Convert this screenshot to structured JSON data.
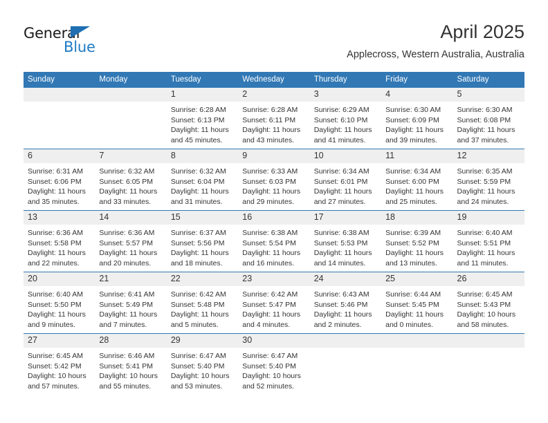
{
  "logo": {
    "word_one": "General",
    "word_two": "Blue",
    "flag_icon": "triangle-flag-icon",
    "accent_color": "#1f7ac4"
  },
  "header": {
    "title": "April 2025",
    "subtitle": "Applecross, Western Australia, Australia"
  },
  "theme": {
    "header_blue": "#3178b5",
    "daynum_gray": "#efefef",
    "text": "#333333"
  },
  "weekday_headers": [
    "Sunday",
    "Monday",
    "Tuesday",
    "Wednesday",
    "Thursday",
    "Friday",
    "Saturday"
  ],
  "weeks": [
    [
      {
        "day": "",
        "lines": []
      },
      {
        "day": "",
        "lines": []
      },
      {
        "day": "1",
        "lines": [
          "Sunrise: 6:28 AM",
          "Sunset: 6:13 PM",
          "Daylight: 11 hours",
          "and 45 minutes."
        ]
      },
      {
        "day": "2",
        "lines": [
          "Sunrise: 6:28 AM",
          "Sunset: 6:11 PM",
          "Daylight: 11 hours",
          "and 43 minutes."
        ]
      },
      {
        "day": "3",
        "lines": [
          "Sunrise: 6:29 AM",
          "Sunset: 6:10 PM",
          "Daylight: 11 hours",
          "and 41 minutes."
        ]
      },
      {
        "day": "4",
        "lines": [
          "Sunrise: 6:30 AM",
          "Sunset: 6:09 PM",
          "Daylight: 11 hours",
          "and 39 minutes."
        ]
      },
      {
        "day": "5",
        "lines": [
          "Sunrise: 6:30 AM",
          "Sunset: 6:08 PM",
          "Daylight: 11 hours",
          "and 37 minutes."
        ]
      }
    ],
    [
      {
        "day": "6",
        "lines": [
          "Sunrise: 6:31 AM",
          "Sunset: 6:06 PM",
          "Daylight: 11 hours",
          "and 35 minutes."
        ]
      },
      {
        "day": "7",
        "lines": [
          "Sunrise: 6:32 AM",
          "Sunset: 6:05 PM",
          "Daylight: 11 hours",
          "and 33 minutes."
        ]
      },
      {
        "day": "8",
        "lines": [
          "Sunrise: 6:32 AM",
          "Sunset: 6:04 PM",
          "Daylight: 11 hours",
          "and 31 minutes."
        ]
      },
      {
        "day": "9",
        "lines": [
          "Sunrise: 6:33 AM",
          "Sunset: 6:03 PM",
          "Daylight: 11 hours",
          "and 29 minutes."
        ]
      },
      {
        "day": "10",
        "lines": [
          "Sunrise: 6:34 AM",
          "Sunset: 6:01 PM",
          "Daylight: 11 hours",
          "and 27 minutes."
        ]
      },
      {
        "day": "11",
        "lines": [
          "Sunrise: 6:34 AM",
          "Sunset: 6:00 PM",
          "Daylight: 11 hours",
          "and 25 minutes."
        ]
      },
      {
        "day": "12",
        "lines": [
          "Sunrise: 6:35 AM",
          "Sunset: 5:59 PM",
          "Daylight: 11 hours",
          "and 24 minutes."
        ]
      }
    ],
    [
      {
        "day": "13",
        "lines": [
          "Sunrise: 6:36 AM",
          "Sunset: 5:58 PM",
          "Daylight: 11 hours",
          "and 22 minutes."
        ]
      },
      {
        "day": "14",
        "lines": [
          "Sunrise: 6:36 AM",
          "Sunset: 5:57 PM",
          "Daylight: 11 hours",
          "and 20 minutes."
        ]
      },
      {
        "day": "15",
        "lines": [
          "Sunrise: 6:37 AM",
          "Sunset: 5:56 PM",
          "Daylight: 11 hours",
          "and 18 minutes."
        ]
      },
      {
        "day": "16",
        "lines": [
          "Sunrise: 6:38 AM",
          "Sunset: 5:54 PM",
          "Daylight: 11 hours",
          "and 16 minutes."
        ]
      },
      {
        "day": "17",
        "lines": [
          "Sunrise: 6:38 AM",
          "Sunset: 5:53 PM",
          "Daylight: 11 hours",
          "and 14 minutes."
        ]
      },
      {
        "day": "18",
        "lines": [
          "Sunrise: 6:39 AM",
          "Sunset: 5:52 PM",
          "Daylight: 11 hours",
          "and 13 minutes."
        ]
      },
      {
        "day": "19",
        "lines": [
          "Sunrise: 6:40 AM",
          "Sunset: 5:51 PM",
          "Daylight: 11 hours",
          "and 11 minutes."
        ]
      }
    ],
    [
      {
        "day": "20",
        "lines": [
          "Sunrise: 6:40 AM",
          "Sunset: 5:50 PM",
          "Daylight: 11 hours",
          "and 9 minutes."
        ]
      },
      {
        "day": "21",
        "lines": [
          "Sunrise: 6:41 AM",
          "Sunset: 5:49 PM",
          "Daylight: 11 hours",
          "and 7 minutes."
        ]
      },
      {
        "day": "22",
        "lines": [
          "Sunrise: 6:42 AM",
          "Sunset: 5:48 PM",
          "Daylight: 11 hours",
          "and 5 minutes."
        ]
      },
      {
        "day": "23",
        "lines": [
          "Sunrise: 6:42 AM",
          "Sunset: 5:47 PM",
          "Daylight: 11 hours",
          "and 4 minutes."
        ]
      },
      {
        "day": "24",
        "lines": [
          "Sunrise: 6:43 AM",
          "Sunset: 5:46 PM",
          "Daylight: 11 hours",
          "and 2 minutes."
        ]
      },
      {
        "day": "25",
        "lines": [
          "Sunrise: 6:44 AM",
          "Sunset: 5:45 PM",
          "Daylight: 11 hours",
          "and 0 minutes."
        ]
      },
      {
        "day": "26",
        "lines": [
          "Sunrise: 6:45 AM",
          "Sunset: 5:43 PM",
          "Daylight: 10 hours",
          "and 58 minutes."
        ]
      }
    ],
    [
      {
        "day": "27",
        "lines": [
          "Sunrise: 6:45 AM",
          "Sunset: 5:42 PM",
          "Daylight: 10 hours",
          "and 57 minutes."
        ]
      },
      {
        "day": "28",
        "lines": [
          "Sunrise: 6:46 AM",
          "Sunset: 5:41 PM",
          "Daylight: 10 hours",
          "and 55 minutes."
        ]
      },
      {
        "day": "29",
        "lines": [
          "Sunrise: 6:47 AM",
          "Sunset: 5:40 PM",
          "Daylight: 10 hours",
          "and 53 minutes."
        ]
      },
      {
        "day": "30",
        "lines": [
          "Sunrise: 6:47 AM",
          "Sunset: 5:40 PM",
          "Daylight: 10 hours",
          "and 52 minutes."
        ]
      },
      {
        "day": "",
        "lines": []
      },
      {
        "day": "",
        "lines": []
      },
      {
        "day": "",
        "lines": []
      }
    ]
  ]
}
